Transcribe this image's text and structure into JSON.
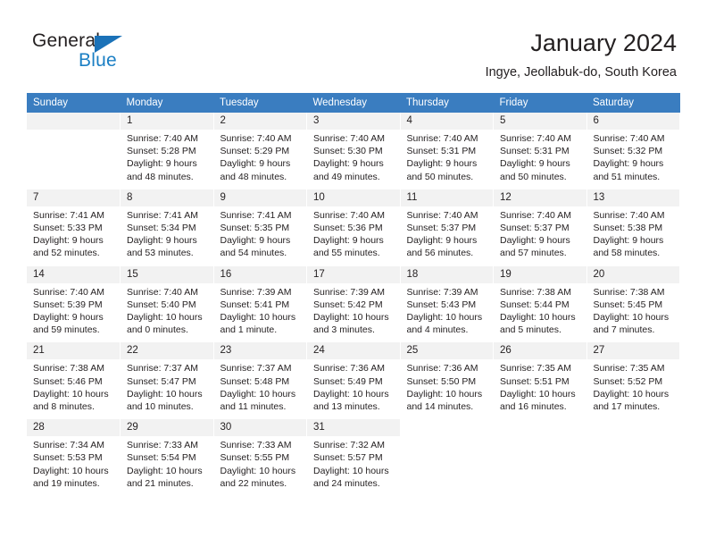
{
  "brand": {
    "word_one": "General",
    "word_two": "Blue",
    "logo_icon": "triangle-icon",
    "accent_color": "#1b7fc4"
  },
  "header": {
    "title": "January 2024",
    "subtitle": "Ingye, Jeollabuk-do, South Korea"
  },
  "calendar": {
    "header_bg": "#3a7dc0",
    "daynum_bg": "#f2f2f2",
    "weekday_headers": [
      "Sunday",
      "Monday",
      "Tuesday",
      "Wednesday",
      "Thursday",
      "Friday",
      "Saturday"
    ],
    "weeks": [
      [
        {
          "day": "",
          "lines": []
        },
        {
          "day": "1",
          "lines": [
            "Sunrise: 7:40 AM",
            "Sunset: 5:28 PM",
            "Daylight: 9 hours",
            "and 48 minutes."
          ]
        },
        {
          "day": "2",
          "lines": [
            "Sunrise: 7:40 AM",
            "Sunset: 5:29 PM",
            "Daylight: 9 hours",
            "and 48 minutes."
          ]
        },
        {
          "day": "3",
          "lines": [
            "Sunrise: 7:40 AM",
            "Sunset: 5:30 PM",
            "Daylight: 9 hours",
            "and 49 minutes."
          ]
        },
        {
          "day": "4",
          "lines": [
            "Sunrise: 7:40 AM",
            "Sunset: 5:31 PM",
            "Daylight: 9 hours",
            "and 50 minutes."
          ]
        },
        {
          "day": "5",
          "lines": [
            "Sunrise: 7:40 AM",
            "Sunset: 5:31 PM",
            "Daylight: 9 hours",
            "and 50 minutes."
          ]
        },
        {
          "day": "6",
          "lines": [
            "Sunrise: 7:40 AM",
            "Sunset: 5:32 PM",
            "Daylight: 9 hours",
            "and 51 minutes."
          ]
        }
      ],
      [
        {
          "day": "7",
          "lines": [
            "Sunrise: 7:41 AM",
            "Sunset: 5:33 PM",
            "Daylight: 9 hours",
            "and 52 minutes."
          ]
        },
        {
          "day": "8",
          "lines": [
            "Sunrise: 7:41 AM",
            "Sunset: 5:34 PM",
            "Daylight: 9 hours",
            "and 53 minutes."
          ]
        },
        {
          "day": "9",
          "lines": [
            "Sunrise: 7:41 AM",
            "Sunset: 5:35 PM",
            "Daylight: 9 hours",
            "and 54 minutes."
          ]
        },
        {
          "day": "10",
          "lines": [
            "Sunrise: 7:40 AM",
            "Sunset: 5:36 PM",
            "Daylight: 9 hours",
            "and 55 minutes."
          ]
        },
        {
          "day": "11",
          "lines": [
            "Sunrise: 7:40 AM",
            "Sunset: 5:37 PM",
            "Daylight: 9 hours",
            "and 56 minutes."
          ]
        },
        {
          "day": "12",
          "lines": [
            "Sunrise: 7:40 AM",
            "Sunset: 5:37 PM",
            "Daylight: 9 hours",
            "and 57 minutes."
          ]
        },
        {
          "day": "13",
          "lines": [
            "Sunrise: 7:40 AM",
            "Sunset: 5:38 PM",
            "Daylight: 9 hours",
            "and 58 minutes."
          ]
        }
      ],
      [
        {
          "day": "14",
          "lines": [
            "Sunrise: 7:40 AM",
            "Sunset: 5:39 PM",
            "Daylight: 9 hours",
            "and 59 minutes."
          ]
        },
        {
          "day": "15",
          "lines": [
            "Sunrise: 7:40 AM",
            "Sunset: 5:40 PM",
            "Daylight: 10 hours",
            "and 0 minutes."
          ]
        },
        {
          "day": "16",
          "lines": [
            "Sunrise: 7:39 AM",
            "Sunset: 5:41 PM",
            "Daylight: 10 hours",
            "and 1 minute."
          ]
        },
        {
          "day": "17",
          "lines": [
            "Sunrise: 7:39 AM",
            "Sunset: 5:42 PM",
            "Daylight: 10 hours",
            "and 3 minutes."
          ]
        },
        {
          "day": "18",
          "lines": [
            "Sunrise: 7:39 AM",
            "Sunset: 5:43 PM",
            "Daylight: 10 hours",
            "and 4 minutes."
          ]
        },
        {
          "day": "19",
          "lines": [
            "Sunrise: 7:38 AM",
            "Sunset: 5:44 PM",
            "Daylight: 10 hours",
            "and 5 minutes."
          ]
        },
        {
          "day": "20",
          "lines": [
            "Sunrise: 7:38 AM",
            "Sunset: 5:45 PM",
            "Daylight: 10 hours",
            "and 7 minutes."
          ]
        }
      ],
      [
        {
          "day": "21",
          "lines": [
            "Sunrise: 7:38 AM",
            "Sunset: 5:46 PM",
            "Daylight: 10 hours",
            "and 8 minutes."
          ]
        },
        {
          "day": "22",
          "lines": [
            "Sunrise: 7:37 AM",
            "Sunset: 5:47 PM",
            "Daylight: 10 hours",
            "and 10 minutes."
          ]
        },
        {
          "day": "23",
          "lines": [
            "Sunrise: 7:37 AM",
            "Sunset: 5:48 PM",
            "Daylight: 10 hours",
            "and 11 minutes."
          ]
        },
        {
          "day": "24",
          "lines": [
            "Sunrise: 7:36 AM",
            "Sunset: 5:49 PM",
            "Daylight: 10 hours",
            "and 13 minutes."
          ]
        },
        {
          "day": "25",
          "lines": [
            "Sunrise: 7:36 AM",
            "Sunset: 5:50 PM",
            "Daylight: 10 hours",
            "and 14 minutes."
          ]
        },
        {
          "day": "26",
          "lines": [
            "Sunrise: 7:35 AM",
            "Sunset: 5:51 PM",
            "Daylight: 10 hours",
            "and 16 minutes."
          ]
        },
        {
          "day": "27",
          "lines": [
            "Sunrise: 7:35 AM",
            "Sunset: 5:52 PM",
            "Daylight: 10 hours",
            "and 17 minutes."
          ]
        }
      ],
      [
        {
          "day": "28",
          "lines": [
            "Sunrise: 7:34 AM",
            "Sunset: 5:53 PM",
            "Daylight: 10 hours",
            "and 19 minutes."
          ]
        },
        {
          "day": "29",
          "lines": [
            "Sunrise: 7:33 AM",
            "Sunset: 5:54 PM",
            "Daylight: 10 hours",
            "and 21 minutes."
          ]
        },
        {
          "day": "30",
          "lines": [
            "Sunrise: 7:33 AM",
            "Sunset: 5:55 PM",
            "Daylight: 10 hours",
            "and 22 minutes."
          ]
        },
        {
          "day": "31",
          "lines": [
            "Sunrise: 7:32 AM",
            "Sunset: 5:57 PM",
            "Daylight: 10 hours",
            "and 24 minutes."
          ]
        },
        {
          "day": "",
          "lines": []
        },
        {
          "day": "",
          "lines": []
        },
        {
          "day": "",
          "lines": []
        }
      ]
    ]
  }
}
